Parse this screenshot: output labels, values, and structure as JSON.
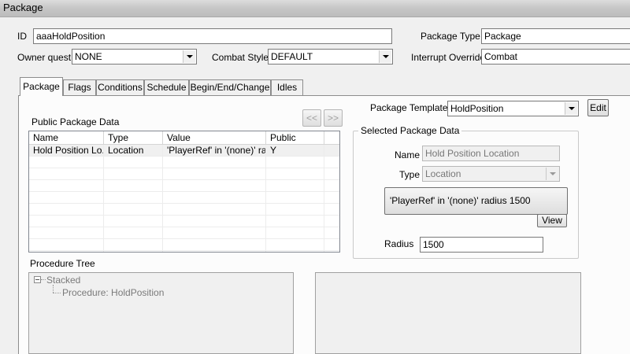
{
  "window": {
    "title": "Package"
  },
  "form": {
    "id_label": "ID",
    "id_value": "aaaHoldPosition",
    "package_type_label": "Package Type",
    "package_type_value": "Package",
    "owner_quest_label": "Owner quest",
    "owner_quest_value": "NONE",
    "combat_style_label": "Combat Style",
    "combat_style_value": "DEFAULT",
    "interrupt_override_label": "Interrupt Override",
    "interrupt_override_value": "Combat"
  },
  "tabs": [
    {
      "label": "Package",
      "active": true
    },
    {
      "label": "Flags"
    },
    {
      "label": "Conditions"
    },
    {
      "label": "Schedule"
    },
    {
      "label": "Begin/End/Change"
    },
    {
      "label": "Idles"
    }
  ],
  "package_tab": {
    "public_data_label": "Public Package Data",
    "prev_label": "<<",
    "next_label": ">>",
    "columns": [
      "Name",
      "Type",
      "Value",
      "Public"
    ],
    "rows": [
      {
        "name": "Hold Position Lo...",
        "type": "Location",
        "value": "'PlayerRef' in '(none)' ra...",
        "public": "Y"
      }
    ],
    "template_label": "Package Template",
    "template_value": "HoldPosition",
    "edit_label": "Edit",
    "selected": {
      "title": "Selected Package Data",
      "name_label": "Name",
      "name_value": "Hold Position Location",
      "type_label": "Type",
      "type_value": "Location",
      "location_button": "'PlayerRef' in '(none)' radius 1500",
      "view_label": "View",
      "radius_label": "Radius",
      "radius_value": "1500"
    },
    "procedure_tree_label": "Procedure Tree",
    "tree": {
      "root": "Stacked",
      "child": "Procedure: HoldPosition"
    }
  }
}
